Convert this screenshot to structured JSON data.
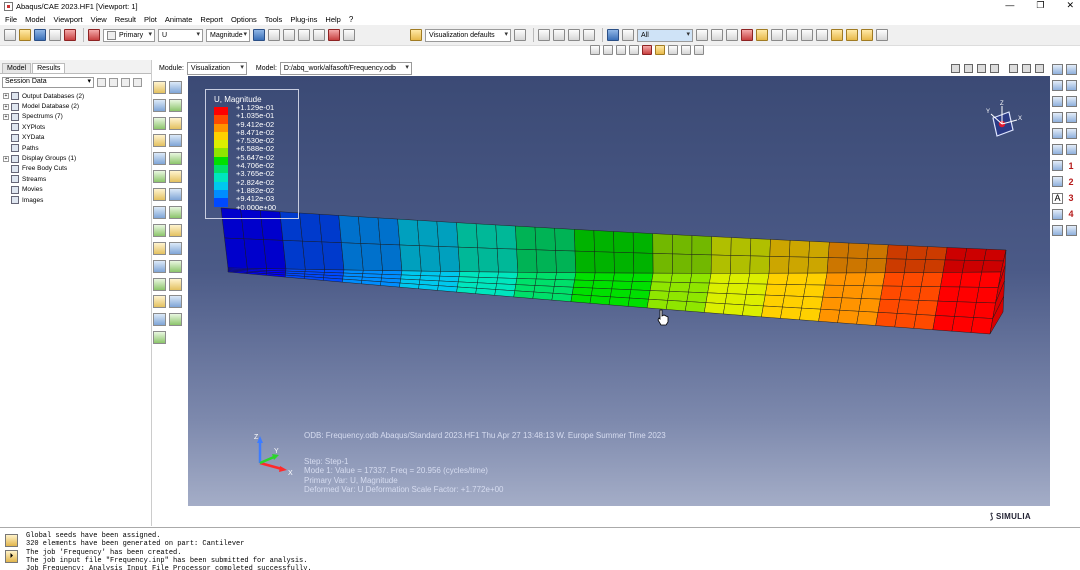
{
  "window": {
    "title": "Abaqus/CAE 2023.HF1 [Viewport: 1]",
    "controls": [
      "—",
      "❐",
      "✕"
    ]
  },
  "menu": [
    "File",
    "Model",
    "Viewport",
    "View",
    "Result",
    "Plot",
    "Animate",
    "Report",
    "Options",
    "Tools",
    "Plug-ins",
    "Help",
    "?"
  ],
  "toolbar": {
    "primary_select": "Primary",
    "variable_select": "U",
    "invariant_select": "Magnitude",
    "visualization_defaults": "Visualization defaults",
    "selection_filter": "All"
  },
  "left_panel": {
    "tabs": [
      "Model",
      "Results"
    ],
    "active_tab": "Results",
    "session_select": "Session Data",
    "tree": [
      {
        "label": "Output Databases (2)",
        "expandable": true
      },
      {
        "label": "Model Database (2)",
        "expandable": true
      },
      {
        "label": "Spectrums (7)",
        "expandable": true
      },
      {
        "label": "XYPlots",
        "expandable": false
      },
      {
        "label": "XYData",
        "expandable": false
      },
      {
        "label": "Paths",
        "expandable": false
      },
      {
        "label": "Display Groups (1)",
        "expandable": true
      },
      {
        "label": "Free Body Cuts",
        "expandable": false
      },
      {
        "label": "Streams",
        "expandable": false
      },
      {
        "label": "Movies",
        "expandable": false
      },
      {
        "label": "Images",
        "expandable": false
      }
    ]
  },
  "context": {
    "module_label": "Module:",
    "module_value": "Visualization",
    "model_label": "Model:",
    "model_value": "D:/abq_work/alfasoft/Frequency.odb"
  },
  "legend": {
    "title": "U, Magnitude",
    "values": [
      "+1.129e-01",
      "+1.035e-01",
      "+9.412e-02",
      "+8.471e-02",
      "+7.530e-02",
      "+6.588e-02",
      "+5.647e-02",
      "+4.706e-02",
      "+3.765e-02",
      "+2.824e-02",
      "+1.882e-02",
      "+9.412e-03",
      "+0.000e+00"
    ],
    "colors": [
      "#ff0000",
      "#ff4a00",
      "#ff9400",
      "#ffd000",
      "#dcef00",
      "#8fe600",
      "#00e000",
      "#00e06a",
      "#00e6be",
      "#00c8ee",
      "#008dff",
      "#0049ff",
      "#0000ff"
    ]
  },
  "viewport": {
    "odb_line": "ODB: Frequency.odb    Abaqus/Standard 2023.HF1    Thu Apr 27 13:48:13 W. Europe Summer Time 2023",
    "step_lines": [
      "Step: Step-1",
      "Mode        1: Value =   17337.     Freq =   20.956     (cycles/time)",
      "Primary Var: U, Magnitude",
      "Deformed Var: U   Deformation Scale Factor: +1.772e+00"
    ],
    "axis_labels": {
      "z": "Z",
      "y": "Y",
      "x": "X"
    },
    "cube_axis_labels": {
      "z": "Z",
      "y": "Y",
      "x": "X"
    },
    "brand": "SIMULIA"
  },
  "right_toolbar": {
    "numbers": [
      "1",
      "2",
      "3",
      "4"
    ],
    "text_tool": "A"
  },
  "messages": [
    "Global seeds have been assigned.",
    "320 elements have been generated on part: Cantilever",
    "The job 'Frequency' has been created.",
    "The job input file \"Frequency.inp\" has been submitted for analysis.",
    "Job Frequency: Analysis Input File Processor completed successfully."
  ]
}
